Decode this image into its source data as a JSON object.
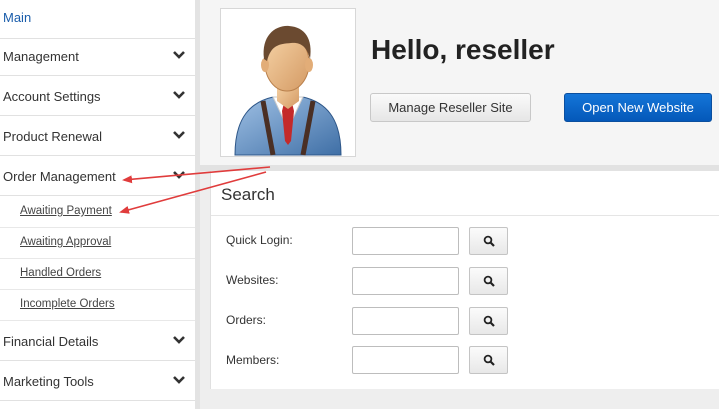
{
  "sidebar": {
    "items": [
      {
        "label": "Main"
      },
      {
        "label": "Management"
      },
      {
        "label": "Account Settings"
      },
      {
        "label": "Product Renewal"
      },
      {
        "label": "Order Management"
      },
      {
        "label": "Financial Details"
      },
      {
        "label": "Marketing Tools"
      }
    ],
    "sub_items": [
      {
        "label": "Awaiting Payment"
      },
      {
        "label": "Awaiting Approval"
      },
      {
        "label": "Handled Orders"
      },
      {
        "label": "Incomplete Orders"
      }
    ]
  },
  "header": {
    "greeting": "Hello, reseller",
    "manage_button": "Manage Reseller Site",
    "open_button": "Open New Website"
  },
  "search": {
    "title": "Search",
    "rows": [
      {
        "label": "Quick Login:",
        "value": ""
      },
      {
        "label": "Websites:",
        "value": ""
      },
      {
        "label": "Orders:",
        "value": ""
      },
      {
        "label": "Members:",
        "value": ""
      }
    ]
  },
  "colors": {
    "accent": "#0458b9",
    "link": "#1a5dab",
    "annotation": "#e03c3c"
  }
}
